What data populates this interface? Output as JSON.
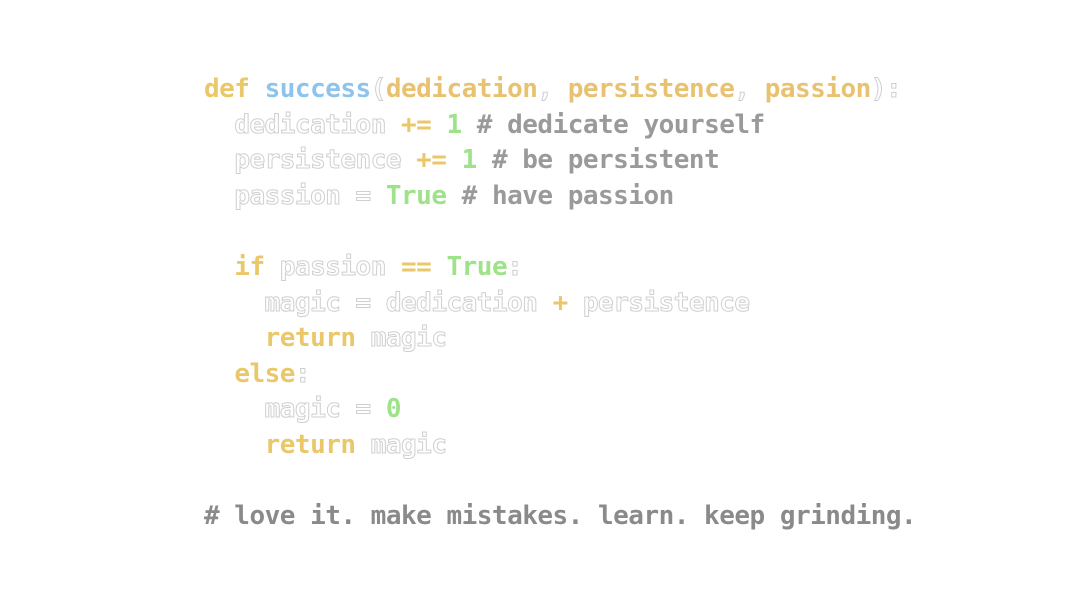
{
  "code": {
    "lines": [
      [
        {
          "t": "def",
          "c": "kw"
        },
        {
          "t": " ",
          "c": "punct"
        },
        {
          "t": "success",
          "c": "fn"
        },
        {
          "t": "(",
          "c": "punct"
        },
        {
          "t": "dedication",
          "c": "param"
        },
        {
          "t": ", ",
          "c": "punct"
        },
        {
          "t": "persistence",
          "c": "param"
        },
        {
          "t": ", ",
          "c": "punct"
        },
        {
          "t": "passion",
          "c": "param"
        },
        {
          "t": "):",
          "c": "punct"
        }
      ],
      [
        {
          "t": "  ",
          "c": "punct"
        },
        {
          "t": "dedication",
          "c": "var"
        },
        {
          "t": " ",
          "c": "punct"
        },
        {
          "t": "+=",
          "c": "op"
        },
        {
          "t": " ",
          "c": "punct"
        },
        {
          "t": "1",
          "c": "num"
        },
        {
          "t": " ",
          "c": "punct"
        },
        {
          "t": "# dedicate yourself",
          "c": "comment"
        }
      ],
      [
        {
          "t": "  ",
          "c": "punct"
        },
        {
          "t": "persistence",
          "c": "var"
        },
        {
          "t": " ",
          "c": "punct"
        },
        {
          "t": "+=",
          "c": "op"
        },
        {
          "t": " ",
          "c": "punct"
        },
        {
          "t": "1",
          "c": "num"
        },
        {
          "t": " ",
          "c": "punct"
        },
        {
          "t": "# be persistent",
          "c": "comment"
        }
      ],
      [
        {
          "t": "  ",
          "c": "punct"
        },
        {
          "t": "passion",
          "c": "var"
        },
        {
          "t": " = ",
          "c": "punct"
        },
        {
          "t": "True",
          "c": "bool"
        },
        {
          "t": " ",
          "c": "punct"
        },
        {
          "t": "# have passion",
          "c": "comment"
        }
      ],
      [],
      [
        {
          "t": "  ",
          "c": "punct"
        },
        {
          "t": "if",
          "c": "kw"
        },
        {
          "t": " ",
          "c": "punct"
        },
        {
          "t": "passion",
          "c": "var"
        },
        {
          "t": " ",
          "c": "punct"
        },
        {
          "t": "==",
          "c": "op"
        },
        {
          "t": " ",
          "c": "punct"
        },
        {
          "t": "True",
          "c": "bool"
        },
        {
          "t": ":",
          "c": "punct"
        }
      ],
      [
        {
          "t": "    ",
          "c": "punct"
        },
        {
          "t": "magic",
          "c": "var"
        },
        {
          "t": " = ",
          "c": "punct"
        },
        {
          "t": "dedication",
          "c": "var"
        },
        {
          "t": " ",
          "c": "punct"
        },
        {
          "t": "+",
          "c": "op"
        },
        {
          "t": " ",
          "c": "punct"
        },
        {
          "t": "persistence",
          "c": "var"
        }
      ],
      [
        {
          "t": "    ",
          "c": "punct"
        },
        {
          "t": "return",
          "c": "kw"
        },
        {
          "t": " ",
          "c": "punct"
        },
        {
          "t": "magic",
          "c": "var"
        }
      ],
      [
        {
          "t": "  ",
          "c": "punct"
        },
        {
          "t": "else",
          "c": "kw"
        },
        {
          "t": ":",
          "c": "punct"
        }
      ],
      [
        {
          "t": "    ",
          "c": "punct"
        },
        {
          "t": "magic",
          "c": "var"
        },
        {
          "t": " = ",
          "c": "punct"
        },
        {
          "t": "0",
          "c": "num"
        }
      ],
      [
        {
          "t": "    ",
          "c": "punct"
        },
        {
          "t": "return",
          "c": "kw"
        },
        {
          "t": " ",
          "c": "punct"
        },
        {
          "t": "magic",
          "c": "var"
        }
      ],
      [],
      [
        {
          "t": "# love it. make mistakes. learn. keep grinding.",
          "c": "comment-dark"
        }
      ]
    ]
  },
  "colors": {
    "keyword": "#eac86a",
    "function": "#8ec4ec",
    "parameter": "#e8c270",
    "number": "#9ee28a",
    "comment": "#9a9a9a",
    "background": "#ffffff"
  }
}
